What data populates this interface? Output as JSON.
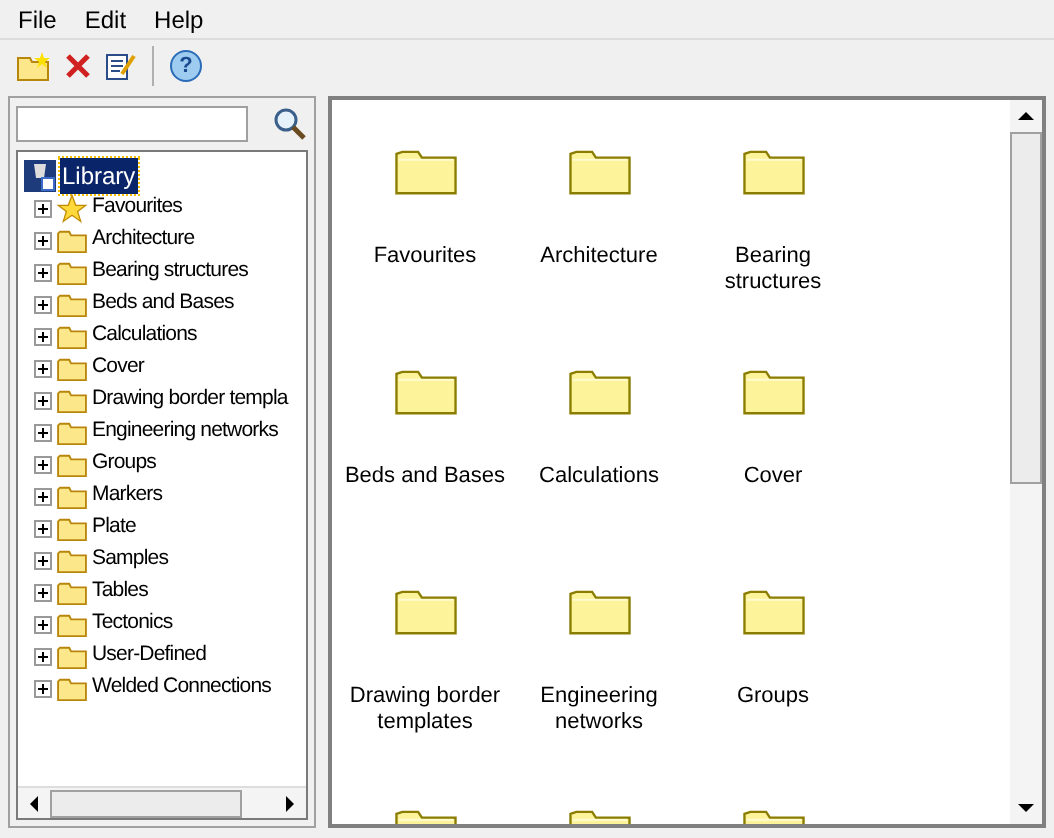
{
  "menu": [
    "File",
    "Edit",
    "Help"
  ],
  "help_button": "?",
  "tree": {
    "root": {
      "label": "Library",
      "selected": true
    },
    "children": [
      {
        "label": "Favourites",
        "kind": "star",
        "expanded": false
      },
      {
        "label": "Architecture",
        "kind": "folder",
        "expanded": false
      },
      {
        "label": "Bearing structures",
        "kind": "folder",
        "expanded": false
      },
      {
        "label": "Beds and Bases",
        "kind": "folder",
        "expanded": false
      },
      {
        "label": "Calculations",
        "kind": "folder",
        "expanded": false
      },
      {
        "label": "Cover",
        "kind": "folder",
        "expanded": false
      },
      {
        "label": "Drawing border templa",
        "kind": "folder",
        "expanded": false
      },
      {
        "label": "Engineering networks",
        "kind": "folder",
        "expanded": false
      },
      {
        "label": "Groups",
        "kind": "folder",
        "expanded": false
      },
      {
        "label": "Markers",
        "kind": "folder",
        "expanded": false
      },
      {
        "label": "Plate",
        "kind": "folder",
        "expanded": false
      },
      {
        "label": "Samples",
        "kind": "folder",
        "expanded": false
      },
      {
        "label": "Tables",
        "kind": "folder",
        "expanded": false
      },
      {
        "label": "Tectonics",
        "kind": "folder",
        "expanded": false
      },
      {
        "label": "User-Defined",
        "kind": "folder",
        "expanded": false
      },
      {
        "label": "Welded Connections",
        "kind": "folder",
        "expanded": false
      }
    ]
  },
  "grid": [
    "Favourites",
    "Architecture",
    "Bearing structures",
    "Beds and Bases",
    "Calculations",
    "Cover",
    "Drawing border templates",
    "Engineering networks",
    "Groups"
  ]
}
